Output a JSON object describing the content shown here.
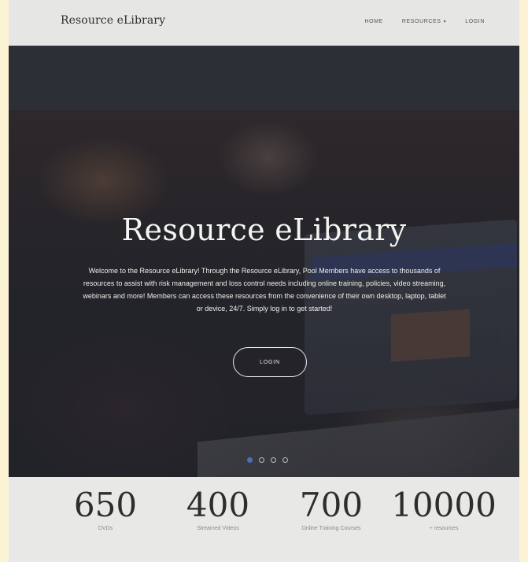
{
  "header": {
    "brand": "Resource eLibrary",
    "nav": [
      {
        "label": "HOME"
      },
      {
        "label": "RESOURCES",
        "caret": "▾"
      },
      {
        "label": "LOGIN"
      }
    ]
  },
  "hero": {
    "title": "Resource eLibrary",
    "text": "Welcome to the Resource eLibrary! Through the Resource eLibrary, Pool Members have access to thousands of resources to assist with risk management and loss control needs including online training, policies, video streaming, webinars and more! Members can access these resources from the convenience of their own desktop, laptop, tablet or device, 24/7. Simply log in to get started!",
    "login_button": "LOGIN",
    "carousel": {
      "count": 4,
      "active": 0
    }
  },
  "stats": [
    {
      "number": "650",
      "label": "DVDs"
    },
    {
      "number": "400",
      "label": "Streamed Videos"
    },
    {
      "number": "700",
      "label": "Online Training Courses"
    },
    {
      "number": "10000",
      "label": "+ resources"
    }
  ],
  "colors": {
    "page_background": "#fbf3d4",
    "header_background": "#e6e6e4",
    "hero_overlay": "#35373d",
    "active_dot": "#4e6fb8"
  }
}
